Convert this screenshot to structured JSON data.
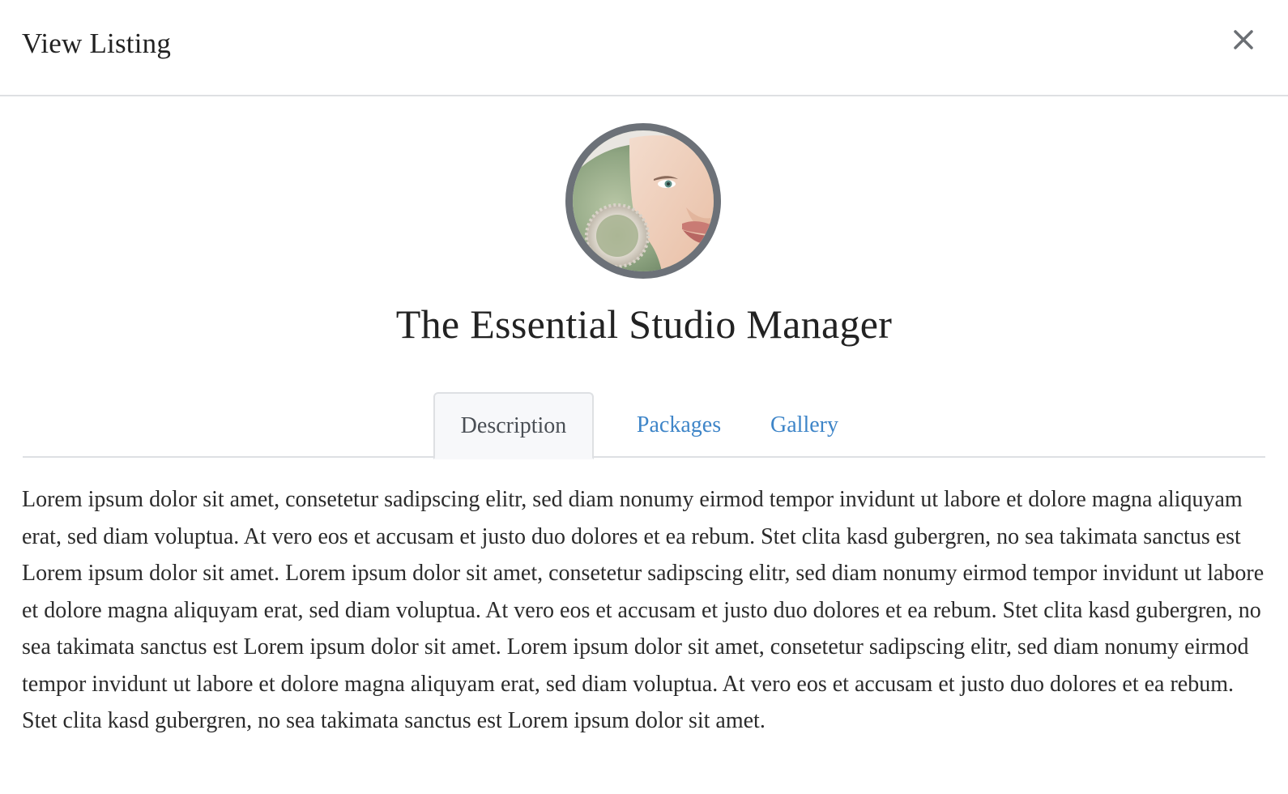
{
  "modal": {
    "title": "View Listing",
    "close_icon": "close-icon"
  },
  "listing": {
    "avatar_icon": "profile-photo",
    "title": "The Essential Studio Manager"
  },
  "tabs": [
    {
      "label": "Description",
      "active": true
    },
    {
      "label": "Packages",
      "active": false
    },
    {
      "label": "Gallery",
      "active": false
    }
  ],
  "description": {
    "text": "Lorem ipsum dolor sit amet, consetetur sadipscing elitr, sed diam nonumy eirmod tempor invidunt ut labore et dolore magna aliquyam erat, sed diam voluptua. At vero eos et accusam et justo duo dolores et ea rebum. Stet clita kasd gubergren, no sea takimata sanctus est Lorem ipsum dolor sit amet. Lorem ipsum dolor sit amet, consetetur sadipscing elitr, sed diam nonumy eirmod tempor invidunt ut labore et dolore magna aliquyam erat, sed diam voluptua. At vero eos et accusam et justo duo dolores et ea rebum. Stet clita kasd gubergren, no sea takimata sanctus est Lorem ipsum dolor sit amet. Lorem ipsum dolor sit amet, consetetur sadipscing elitr, sed diam nonumy eirmod tempor invidunt ut labore et dolore magna aliquyam erat, sed diam voluptua. At vero eos et accusam et justo duo dolores et ea rebum. Stet clita kasd gubergren, no sea takimata sanctus est Lorem ipsum dolor sit amet."
  },
  "colors": {
    "link": "#3e85c8",
    "avatar_border": "#6c7178",
    "divider": "#dee0e3",
    "active_tab_bg": "#f7f8fa"
  }
}
